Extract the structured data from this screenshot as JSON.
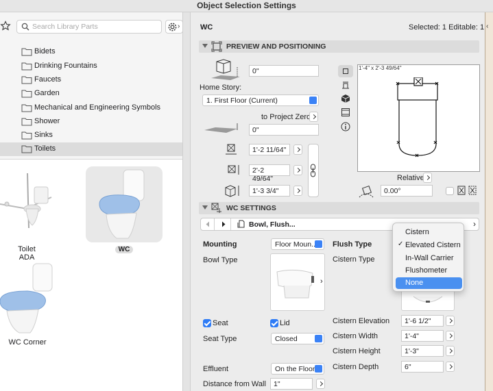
{
  "window": {
    "title": "Object Selection Settings"
  },
  "library": {
    "search_placeholder": "Search Library Parts",
    "folders": [
      {
        "label": "Bidets"
      },
      {
        "label": "Drinking Fountains"
      },
      {
        "label": "Faucets"
      },
      {
        "label": "Garden"
      },
      {
        "label": "Mechanical and Engineering Symbols"
      },
      {
        "label": "Shower"
      },
      {
        "label": "Sinks"
      },
      {
        "label": "Toilets"
      }
    ],
    "selected_folder": "Toilets",
    "tiles": [
      {
        "label": "Toilet ADA"
      },
      {
        "label": "WC",
        "selected": true
      },
      {
        "label": "WC Corner"
      }
    ]
  },
  "header": {
    "object_name": "WC",
    "status": "Selected: 1 Editable: 1"
  },
  "preview": {
    "section_title": "PREVIEW AND POSITIONING",
    "elevation_value": "0\"",
    "home_story_label": "Home Story:",
    "home_story_value": "1. First Floor (Current)",
    "to_project_zero": "to Project Zero",
    "project_zero_value": "0\"",
    "dim_x": "1'-2 11/64\"",
    "dim_y": "2'-2 49/64\"",
    "dim_z": "1'-3 3/4\"",
    "canvas_caption": "1'-4\" x 2'-3 49/64\"",
    "relative_label": "Relative",
    "angle_value": "0.00°"
  },
  "wc_settings": {
    "section_title": "WC SETTINGS",
    "nav_title": "Bowl, Flush...",
    "mounting_label": "Mounting",
    "mounting_value": "Floor Moun...",
    "bowl_type_label": "Bowl Type",
    "flush_type_label": "Flush Type",
    "cistern_type_label": "Cistern Type",
    "seat_label": "Seat",
    "lid_label": "Lid",
    "seat_type_label": "Seat Type",
    "seat_type_value": "Closed",
    "effluent_label": "Effluent",
    "effluent_value": "On the Floor",
    "distance_label": "Distance from Wall",
    "distance_value": "1\"",
    "cistern_elevation_label": "Cistern Elevation",
    "cistern_elevation_value": "1'-6 1/2\"",
    "cistern_width_label": "Cistern Width",
    "cistern_width_value": "1'-4\"",
    "cistern_height_label": "Cistern Height",
    "cistern_height_value": "1'-3\"",
    "cistern_depth_label": "Cistern Depth",
    "cistern_depth_value": "6\""
  },
  "flush_menu": {
    "options": [
      "Cistern",
      "Elevated Cistern",
      "In-Wall Carrier",
      "Flushometer",
      "None"
    ],
    "checked": "Elevated Cistern",
    "highlighted": "None"
  },
  "colors": {
    "accent": "#2f7cf6",
    "menu_highlight": "#4a90f0",
    "toilet_seat": "#9fc0e8"
  }
}
